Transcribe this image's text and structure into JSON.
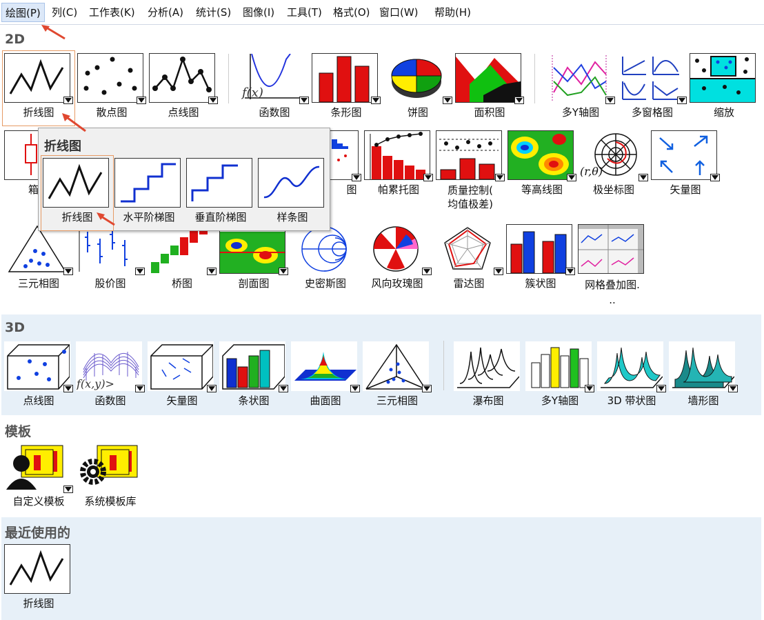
{
  "menu": [
    "绘图(P)",
    "列(C)",
    "工作表(K)",
    "分析(A)",
    "统计(S)",
    "图像(I)",
    "工具(T)",
    "格式(O)",
    "窗口(W)",
    "帮助(H)"
  ],
  "sections": {
    "s2d": "2D",
    "s3d": "3D",
    "templates": "模板",
    "recent": "最近使用的"
  },
  "tiles2d_row1": [
    "折线图",
    "散点图",
    "点线图",
    "函数图",
    "条形图",
    "饼图",
    "面积图",
    "多Y轴图",
    "多窗格图",
    "缩放"
  ],
  "tiles2d_row2": [
    "箱线图",
    "直方图",
    "帕累托图",
    "质量控制(\n均值极差)",
    "等高线图",
    "极坐标图",
    "矢量图"
  ],
  "tiles2d_row2_visible_partial": [
    "箱线",
    "图"
  ],
  "tiles2d_row3": [
    "三元相图",
    "股价图",
    "桥图",
    "剖面图",
    "史密斯图",
    "风向玫瑰图",
    "雷达图",
    "簇状图",
    "网格叠加图.\n.."
  ],
  "tiles3d": [
    "点线图",
    "函数图",
    "矢量图",
    "条状图",
    "曲面图",
    "三元相图",
    "瀑布图",
    "多Y轴图",
    "3D 带状图",
    "墙形图"
  ],
  "templates": [
    "自定义模板",
    "系统模板库"
  ],
  "recent": [
    "折线图"
  ],
  "popup": {
    "title": "折线图",
    "items": [
      "折线图",
      "水平阶梯图",
      "垂直阶梯图",
      "样条图"
    ]
  },
  "colors": {
    "accent": "#e04830",
    "band": "#e7f0f8",
    "menu_active": "#dce8f8"
  }
}
